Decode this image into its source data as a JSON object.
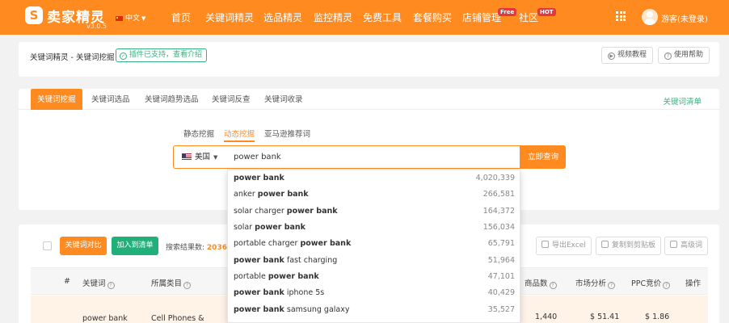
{
  "topnav": {
    "logo_mark": "S",
    "logo_name": "卖家精灵",
    "version": "v3.0.5",
    "language": "中文",
    "items": [
      {
        "label": "首页"
      },
      {
        "label": "关键词精灵"
      },
      {
        "label": "选品精灵"
      },
      {
        "label": "监控精灵"
      },
      {
        "label": "免费工具"
      },
      {
        "label": "套餐购买"
      },
      {
        "label": "店铺管理",
        "badge": "Free"
      },
      {
        "label": "社区",
        "badge": "HOT"
      }
    ],
    "username": "游客(未登录)"
  },
  "breadcrumb": {
    "text": "关键词精灵 - 关键词挖掘",
    "plugin_tag": "插件已支持，查看介绍",
    "video_btn": "视频教程",
    "help_btn": "使用帮助"
  },
  "tabs": {
    "items": [
      "关键词挖掘",
      "关键词选品",
      "关键词趋势选品",
      "关键词反查",
      "关键词收录"
    ],
    "active_index": 0,
    "right_link": "关键词清单"
  },
  "subtabs": {
    "items": [
      "静态挖掘",
      "动态挖掘",
      "亚马逊推荐词"
    ],
    "active_index": 1
  },
  "search": {
    "country": "美国",
    "value": "power bank",
    "button": "立即查询"
  },
  "suggestions": [
    {
      "prefix": "",
      "keyword": "power bank",
      "suffix": "",
      "volume": "4,020,339"
    },
    {
      "prefix": "anker ",
      "keyword": "power bank",
      "suffix": "",
      "volume": "266,581"
    },
    {
      "prefix": "solar charger ",
      "keyword": "power bank",
      "suffix": "",
      "volume": "164,372"
    },
    {
      "prefix": "solar ",
      "keyword": "power bank",
      "suffix": "",
      "volume": "156,034"
    },
    {
      "prefix": "portable charger ",
      "keyword": "power bank",
      "suffix": "",
      "volume": "65,791"
    },
    {
      "prefix": "",
      "keyword": "power bank",
      "suffix": " fast charging",
      "volume": "51,964"
    },
    {
      "prefix": "portable ",
      "keyword": "power bank",
      "suffix": "",
      "volume": "47,101"
    },
    {
      "prefix": "",
      "keyword": "power bank",
      "suffix": " iphone 5s",
      "volume": "40,429"
    },
    {
      "prefix": "",
      "keyword": "power bank",
      "suffix": " samsung galaxy",
      "volume": "35,527"
    }
  ],
  "results": {
    "compare_btn": "关键词对比",
    "add_list_btn": "加入到清单",
    "count_label": "搜索结果数:",
    "count": "2036",
    "export_btn": "导出Excel",
    "copy_btn": "复制到剪贴板",
    "advanced_btn": "高级词",
    "headers": {
      "index": "#",
      "keyword": "关键词",
      "category": "所属类目",
      "products": "商品数",
      "market": "市场分析",
      "ppc": "PPC竞价",
      "action": "操作"
    },
    "row": {
      "keyword": "power bank",
      "category": "Cell Phones &",
      "products": "1,440",
      "market": "$ 51.41",
      "ppc": "$ 1.86"
    }
  }
}
